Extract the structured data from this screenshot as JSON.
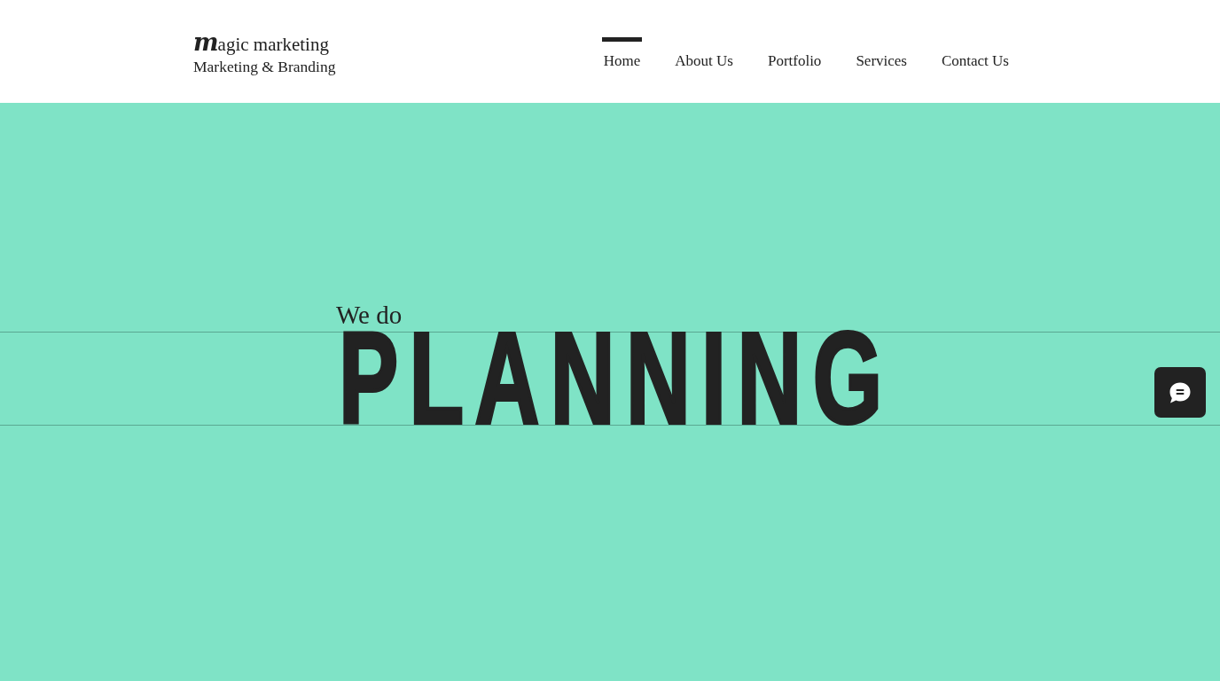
{
  "header": {
    "logo": {
      "title": "**m**agic marketing",
      "tagline": "Marketing & Branding"
    },
    "nav": [
      {
        "label": "Home",
        "selected": true
      },
      {
        "label": "About Us",
        "selected": false
      },
      {
        "label": "Portfolio",
        "selected": false
      },
      {
        "label": "Services",
        "selected": false
      },
      {
        "label": "Contact Us",
        "selected": false
      }
    ]
  },
  "hero": {
    "intro": "We do",
    "headline": "PLANNING"
  }
}
